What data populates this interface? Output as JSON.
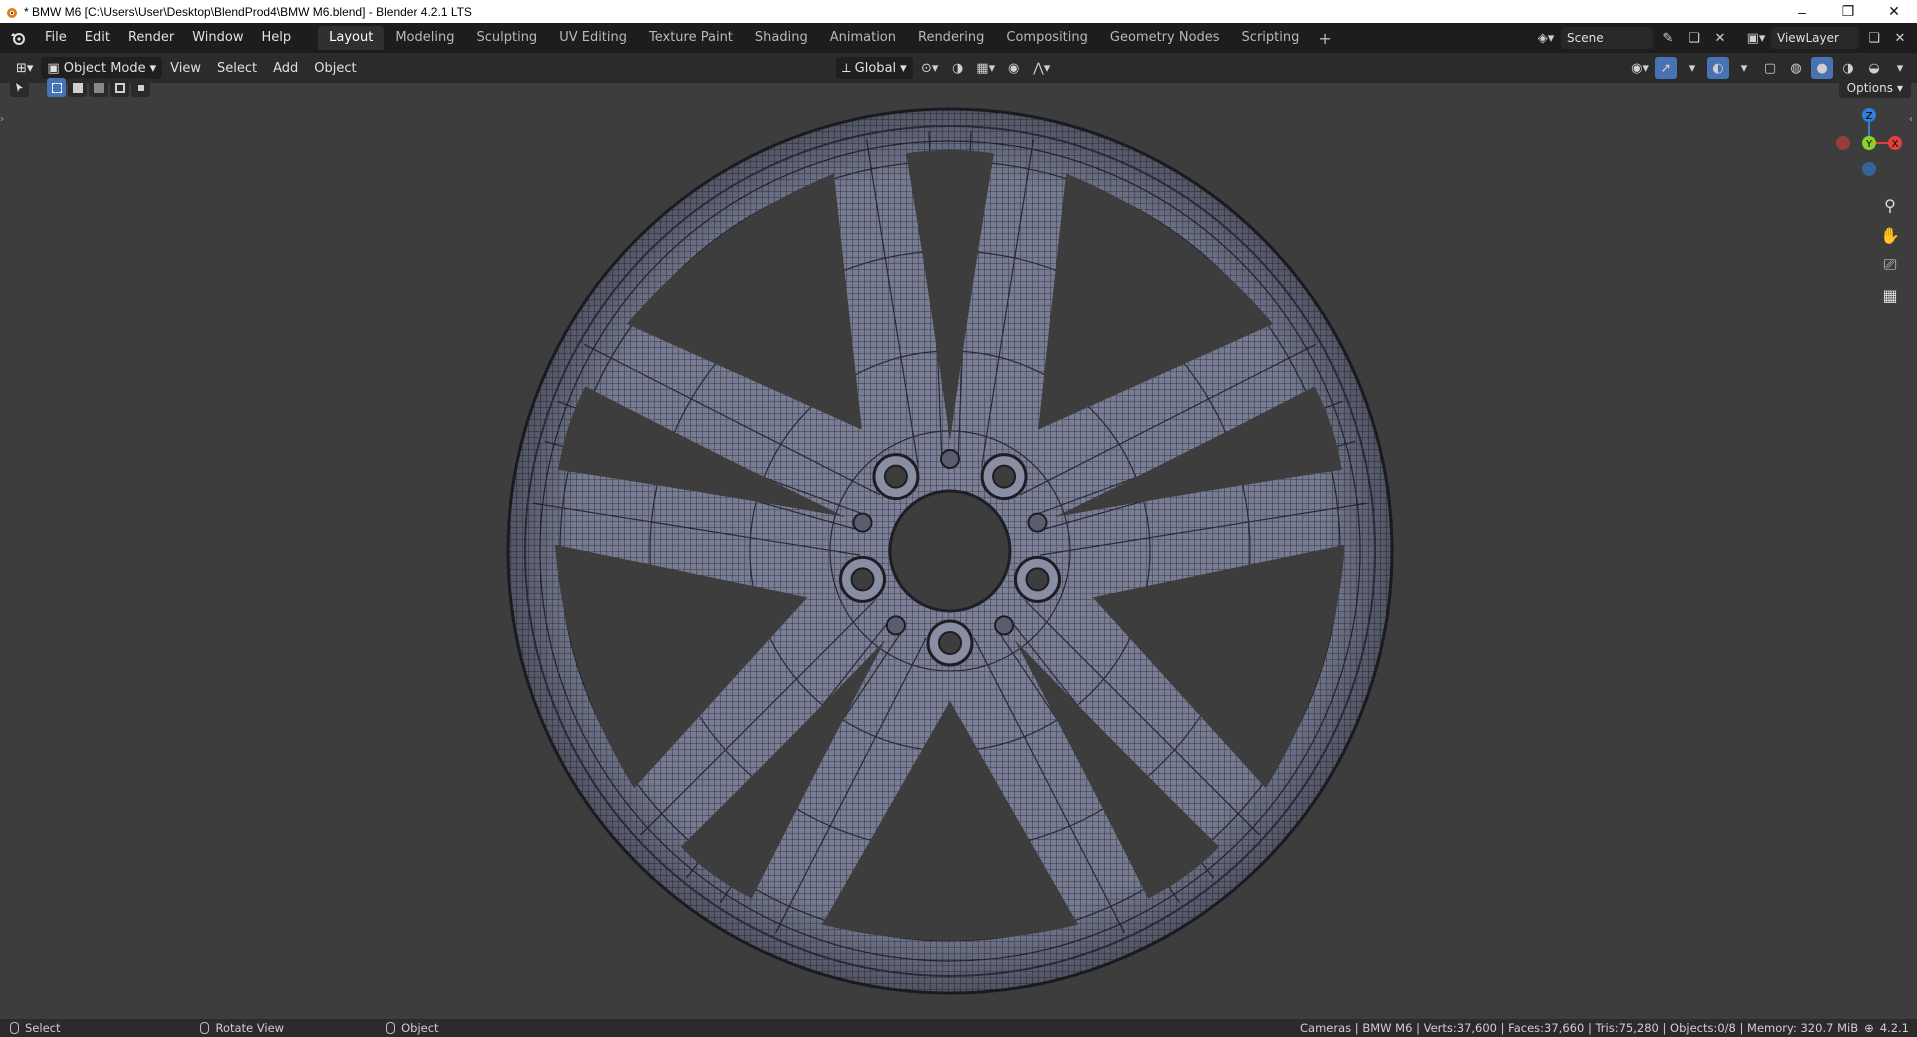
{
  "window": {
    "title": "* BMW M6 [C:\\Users\\User\\Desktop\\BlendProd4\\BMW M6.blend] - Blender 4.2.1 LTS",
    "controls": [
      "–",
      "❐",
      "✕"
    ]
  },
  "menu": {
    "items": [
      "File",
      "Edit",
      "Render",
      "Window",
      "Help"
    ]
  },
  "workspaces": {
    "tabs": [
      "Layout",
      "Modeling",
      "Sculpting",
      "UV Editing",
      "Texture Paint",
      "Shading",
      "Animation",
      "Rendering",
      "Compositing",
      "Geometry Nodes",
      "Scripting"
    ],
    "active": "Layout",
    "add_label": "+"
  },
  "scene": {
    "scene_name": "Scene",
    "view_layer": "ViewLayer"
  },
  "viewport_header": {
    "mode": "Object Mode",
    "menus": [
      "View",
      "Select",
      "Add",
      "Object"
    ],
    "transform_orientation": "Global"
  },
  "viewport": {
    "options_label": "Options",
    "gizmo": {
      "z": "Z",
      "y": "Y",
      "x": "X"
    },
    "wheel": {
      "spokes": 5,
      "lug_nuts": 5,
      "mesh_color": "#7b8096",
      "bg_color": "#3d3d3d"
    }
  },
  "statusbar": {
    "left": [
      {
        "label": "Select"
      },
      {
        "label": "Rotate View"
      },
      {
        "label": "Object"
      }
    ],
    "stats": "Cameras | BMW M6 | Verts:37,600 | Faces:37,660 | Tris:75,280 | Objects:0/8 | Memory: 320.7 MiB",
    "version": "4.2.1"
  },
  "colors": {
    "accent": "#4772b3",
    "axis_x": "#e2403b",
    "axis_y": "#8ad22a",
    "axis_z": "#2f7fd6"
  }
}
